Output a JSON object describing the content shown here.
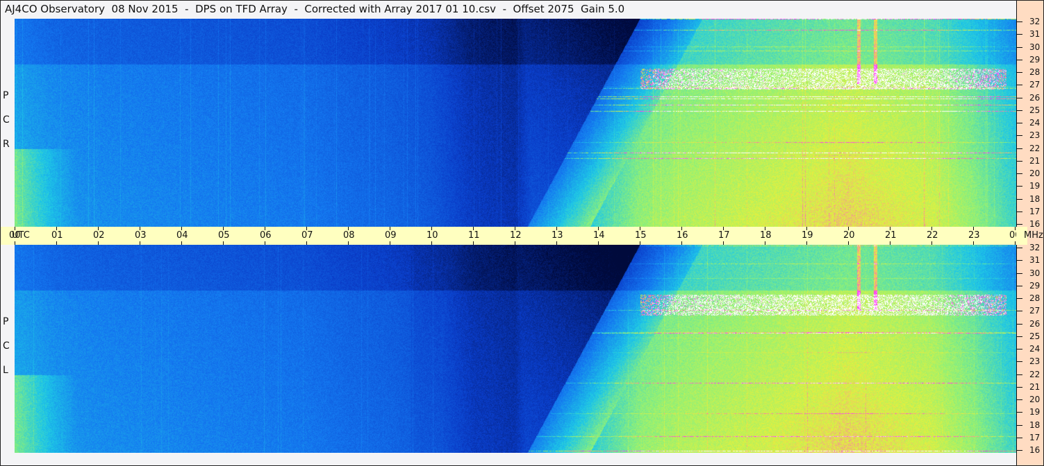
{
  "title": "AJ4CO Observatory  08 Nov 2015  -  DPS on TFD Array  -  Corrected with Array 2017 01 10.csv  -  Offset 2075  Gain 5.0",
  "panels": [
    {
      "label": [
        "R",
        "C",
        "P"
      ],
      "name": "RCP"
    },
    {
      "label": [
        "L",
        "C",
        "P"
      ],
      "name": "LCP"
    }
  ],
  "chart_data": {
    "type": "heatmap",
    "title": "AJ4CO Observatory  08 Nov 2015  -  DPS on TFD Array  -  Corrected with Array 2017 01 10.csv  -  Offset 2075  Gain 5.0",
    "xlabel": "UTC",
    "ylabel": "MHz",
    "x_ticks": [
      "00",
      "01",
      "02",
      "03",
      "04",
      "05",
      "06",
      "07",
      "08",
      "09",
      "10",
      "11",
      "12",
      "13",
      "14",
      "15",
      "16",
      "17",
      "18",
      "19",
      "20",
      "21",
      "22",
      "23",
      "00"
    ],
    "y_ticks": [
      32,
      31,
      30,
      29,
      28,
      27,
      26,
      25,
      24,
      23,
      22,
      21,
      20,
      19,
      18,
      17,
      16
    ],
    "xlim_hours": [
      0,
      24
    ],
    "ylim_mhz": [
      16,
      32
    ],
    "series": [
      "RCP",
      "LCP"
    ],
    "hourly_relative_intensity": [
      0.45,
      0.4,
      0.38,
      0.37,
      0.36,
      0.35,
      0.34,
      0.33,
      0.3,
      0.28,
      0.24,
      0.15,
      0.12,
      0.35,
      0.5,
      0.62,
      0.66,
      0.68,
      0.7,
      0.72,
      0.74,
      0.72,
      0.7,
      0.62,
      0.5
    ],
    "colormap": [
      "#000a3c",
      "#0a3cc8",
      "#1478f0",
      "#1ec8e6",
      "#8cf07a",
      "#e6f03c",
      "#ff28ff",
      "#ffffff"
    ]
  },
  "time_axis": {
    "unit_left": "UTC",
    "unit_right": "MHz"
  }
}
